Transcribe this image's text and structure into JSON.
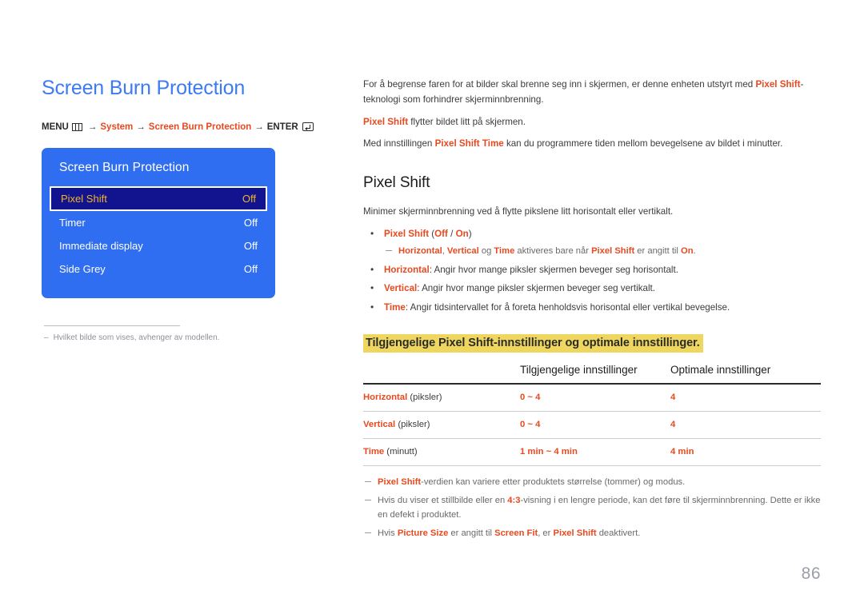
{
  "page": {
    "title": "Screen Burn Protection",
    "number": "86",
    "accent_blue": "#3d7bf0",
    "accent_orange": "#e8491f",
    "highlight_yellow": "#efd75f",
    "osd_blue": "#2f6ef0",
    "osd_selected_bg": "#11138f",
    "osd_selected_text": "#f0b428"
  },
  "breadcrumb": {
    "menu_label": "MENU",
    "menu_icon": "menu-bars-icon",
    "arrow": "→",
    "step1": "System",
    "step2": "Screen Burn Protection",
    "enter_label": "ENTER",
    "enter_icon": "enter-return-icon"
  },
  "osd": {
    "title": "Screen Burn Protection",
    "rows": [
      {
        "label": "Pixel Shift",
        "value": "Off",
        "selected": true
      },
      {
        "label": "Timer",
        "value": "Off",
        "selected": false
      },
      {
        "label": "Immediate display",
        "value": "Off",
        "selected": false
      },
      {
        "label": "Side Grey",
        "value": "Off",
        "selected": false
      }
    ]
  },
  "left_note": {
    "dash": "–",
    "text": "Hvilket bilde som vises, avhenger av modellen."
  },
  "intro": {
    "p1_a": "For å begrense faren for at bilder skal brenne seg inn i skjermen, er denne enheten utstyrt med ",
    "p1_hl": "Pixel Shift",
    "p1_b": "-teknologi som forhindrer skjerminnbrenning.",
    "p2_hl": "Pixel Shift",
    "p2_b": " flytter bildet litt på skjermen.",
    "p3_a": "Med innstillingen ",
    "p3_hl": "Pixel Shift Time",
    "p3_b": " kan du programmere tiden mellom bevegelsene av bildet i minutter."
  },
  "section": {
    "title": "Pixel Shift",
    "lead": "Minimer skjerminnbrenning ved å flytte pikslene litt horisontalt eller vertikalt.",
    "bullets": [
      {
        "hl": "Pixel Shift",
        "rest_a": " (",
        "opt1": "Off",
        "sep": " / ",
        "opt2": "On",
        "rest_b": ")"
      },
      {
        "hl": "Horizontal",
        "rest": ": Angir hvor mange piksler skjermen beveger seg horisontalt."
      },
      {
        "hl": "Vertical",
        "rest": ": Angir hvor mange piksler skjermen beveger seg vertikalt."
      },
      {
        "hl": "Time",
        "rest": ": Angir tidsintervallet for å foreta henholdsvis horisontal eller vertikal bevegelse."
      }
    ],
    "subnote1": {
      "hl1": "Horizontal",
      "comma": ", ",
      "hl2": "Vertical",
      "mid1": " og ",
      "hl3": "Time",
      "mid2": " aktiveres bare når ",
      "hl4": "Pixel Shift",
      "mid3": " er angitt til ",
      "hl5": "On",
      "end": "."
    }
  },
  "yellow_heading": "Tilgjengelige Pixel Shift-innstillinger og optimale innstillinger.",
  "table": {
    "headers": [
      "",
      "Tilgjengelige innstillinger",
      "Optimale innstillinger"
    ],
    "rows": [
      {
        "label": "Horizontal",
        "unit": " (piksler)",
        "available": "0 ~ 4",
        "optimal": "4"
      },
      {
        "label": "Vertical",
        "unit": " (piksler)",
        "available": "0 ~ 4",
        "optimal": "4"
      },
      {
        "label": "Time",
        "unit": " (minutt)",
        "available": "1 min ~ 4 min",
        "optimal": "4 min"
      }
    ]
  },
  "table_notes": [
    {
      "hl": "Pixel Shift",
      "rest": "-verdien kan variere etter produktets størrelse (tommer) og modus."
    },
    {
      "pre": "Hvis du viser et stillbilde eller en ",
      "hl": "4:3",
      "rest": "-visning i en lengre periode, kan det føre til skjerminnbrenning. Dette er ikke en defekt i produktet."
    },
    {
      "pre": "Hvis ",
      "hl": "Picture Size",
      "mid1": " er angitt til ",
      "hl2": "Screen Fit",
      "mid2": ", er ",
      "hl3": "Pixel Shift",
      "rest": " deaktivert."
    }
  ]
}
